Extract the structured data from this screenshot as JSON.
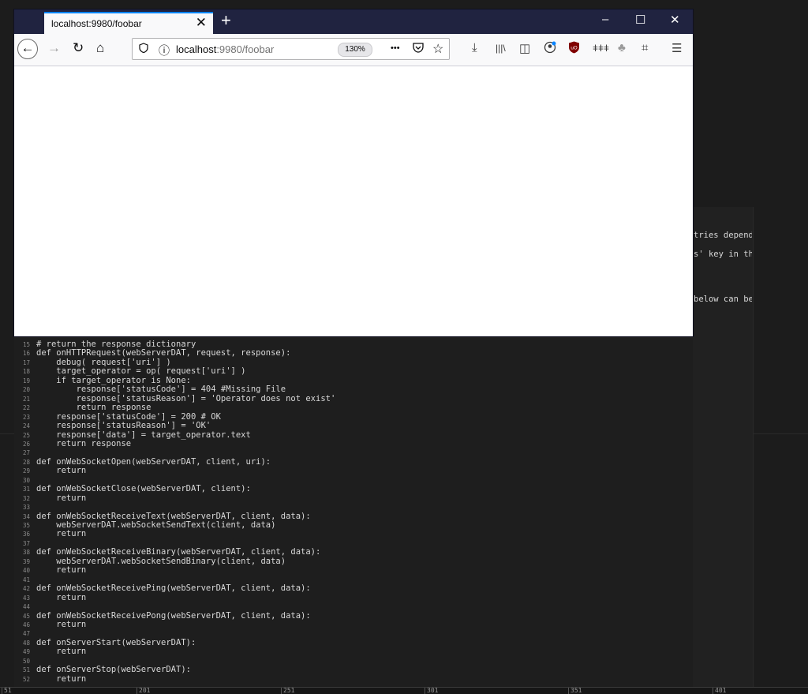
{
  "browser": {
    "tab_title": "localhost:9980/foobar",
    "tab_close": "✕",
    "new_tab": "+",
    "window_buttons": {
      "minimize": "–",
      "maximize": "☐",
      "close": "✕"
    },
    "nav": {
      "back": "←",
      "forward": "→",
      "reload": "↻",
      "home": "⌂"
    },
    "url_host": "localhost",
    "url_rest": ":9980/foobar",
    "zoom": "130%",
    "url_icons": {
      "shield": "shield-icon",
      "info": "ⓘ",
      "more": "•••",
      "pocket": "pocket-icon",
      "star": "☆"
    },
    "toolbar_icons": {
      "download": "⤓",
      "library": "|||\\",
      "sidebar": "◫",
      "account": "☺",
      "ublock": "uBlock",
      "extension1": "ǂǂǂ",
      "extension2": "♣",
      "crop": "⌗",
      "menu": "☰"
    }
  },
  "side_text_fragments": [
    "tries depend",
    "s' key in th",
    "below can be"
  ],
  "code_lines": [
    {
      "n": "15",
      "t": "# return the response dictionary"
    },
    {
      "n": "16",
      "t": "def onHTTPRequest(webServerDAT, request, response):"
    },
    {
      "n": "17",
      "t": "    debug( request['uri'] )"
    },
    {
      "n": "18",
      "t": "    target_operator = op( request['uri'] )"
    },
    {
      "n": "19",
      "t": "    if target_operator is None:"
    },
    {
      "n": "20",
      "t": "        response['statusCode'] = 404 #Missing File"
    },
    {
      "n": "21",
      "t": "        response['statusReason'] = 'Operator does not exist'"
    },
    {
      "n": "22",
      "t": "        return response"
    },
    {
      "n": "23",
      "t": "    response['statusCode'] = 200 # OK"
    },
    {
      "n": "24",
      "t": "    response['statusReason'] = 'OK'"
    },
    {
      "n": "25",
      "t": "    response['data'] = target_operator.text"
    },
    {
      "n": "26",
      "t": "    return response"
    },
    {
      "n": "27",
      "t": ""
    },
    {
      "n": "28",
      "t": "def onWebSocketOpen(webServerDAT, client, uri):"
    },
    {
      "n": "29",
      "t": "    return"
    },
    {
      "n": "30",
      "t": ""
    },
    {
      "n": "31",
      "t": "def onWebSocketClose(webServerDAT, client):"
    },
    {
      "n": "32",
      "t": "    return"
    },
    {
      "n": "33",
      "t": ""
    },
    {
      "n": "34",
      "t": "def onWebSocketReceiveText(webServerDAT, client, data):"
    },
    {
      "n": "35",
      "t": "    webServerDAT.webSocketSendText(client, data)"
    },
    {
      "n": "36",
      "t": "    return"
    },
    {
      "n": "37",
      "t": ""
    },
    {
      "n": "38",
      "t": "def onWebSocketReceiveBinary(webServerDAT, client, data):"
    },
    {
      "n": "39",
      "t": "    webServerDAT.webSocketSendBinary(client, data)"
    },
    {
      "n": "40",
      "t": "    return"
    },
    {
      "n": "41",
      "t": ""
    },
    {
      "n": "42",
      "t": "def onWebSocketReceivePing(webServerDAT, client, data):"
    },
    {
      "n": "43",
      "t": "    return"
    },
    {
      "n": "44",
      "t": ""
    },
    {
      "n": "45",
      "t": "def onWebSocketReceivePong(webServerDAT, client, data):"
    },
    {
      "n": "46",
      "t": "    return"
    },
    {
      "n": "47",
      "t": ""
    },
    {
      "n": "48",
      "t": "def onServerStart(webServerDAT):"
    },
    {
      "n": "49",
      "t": "    return"
    },
    {
      "n": "50",
      "t": ""
    },
    {
      "n": "51",
      "t": "def onServerStop(webServerDAT):"
    },
    {
      "n": "52",
      "t": "    return"
    }
  ],
  "ruler_ticks": [
    "51",
    "201",
    "251",
    "301",
    "351",
    "401"
  ]
}
